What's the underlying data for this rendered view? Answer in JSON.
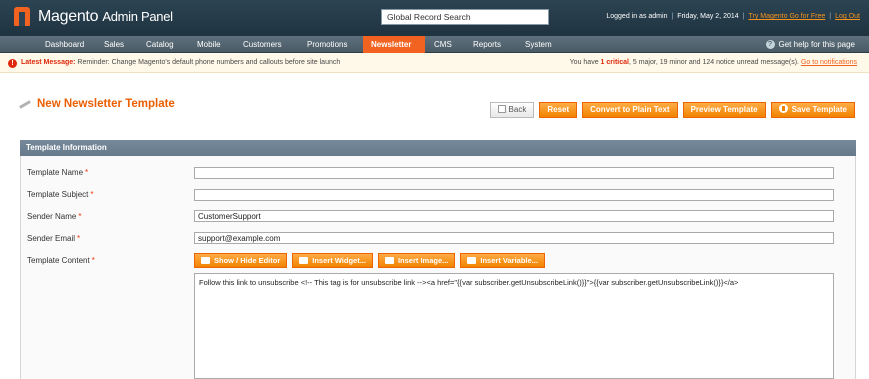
{
  "header": {
    "logo_main": "Magento",
    "logo_sub": "Admin Panel",
    "search_value": "Global Record Search",
    "logged_in": "Logged in as admin",
    "date": "Friday, May 2, 2014",
    "try_link": "Try Magento Go for Free",
    "logout": "Log Out"
  },
  "nav": {
    "items": [
      "Dashboard",
      "Sales",
      "Catalog",
      "Mobile",
      "Customers",
      "Promotions",
      "Newsletter",
      "CMS",
      "Reports",
      "System"
    ],
    "active": "Newsletter",
    "help": "Get help for this page"
  },
  "notice": {
    "label": "Latest Message:",
    "message": "Reminder: Change Magento's default phone numbers and callouts before site launch",
    "right_prefix": "You have",
    "critical_count": "1 critical",
    "right_rest": ", 5 major, 19 minor and 124 notice unread message(s).",
    "link": "Go to notifications"
  },
  "page": {
    "title": "New Newsletter Template",
    "buttons": {
      "back": "Back",
      "reset": "Reset",
      "convert": "Convert to Plain Text",
      "preview": "Preview Template",
      "save": "Save Template"
    }
  },
  "section": {
    "title": "Template Information",
    "fields": {
      "name_label": "Template Name",
      "name_value": "",
      "subject_label": "Template Subject",
      "subject_value": "",
      "sender_name_label": "Sender Name",
      "sender_name_value": "CustomerSupport",
      "sender_email_label": "Sender Email",
      "sender_email_value": "support@example.com",
      "content_label": "Template Content",
      "required_mark": "*"
    },
    "editor_buttons": {
      "toggle": "Show / Hide Editor",
      "widget": "Insert Widget...",
      "image": "Insert Image...",
      "variable": "Insert Variable..."
    },
    "content": "Follow this link to unsubscribe <!-- This tag is for unsubscribe link --><a href=\"{{var subscriber.getUnsubscribeLink()}}\">{{var subscriber.getUnsubscribeLink()}}</a>"
  },
  "colors": {
    "accent": "#f26322",
    "header_bg": "#2c4453",
    "title": "#eb5e00"
  }
}
